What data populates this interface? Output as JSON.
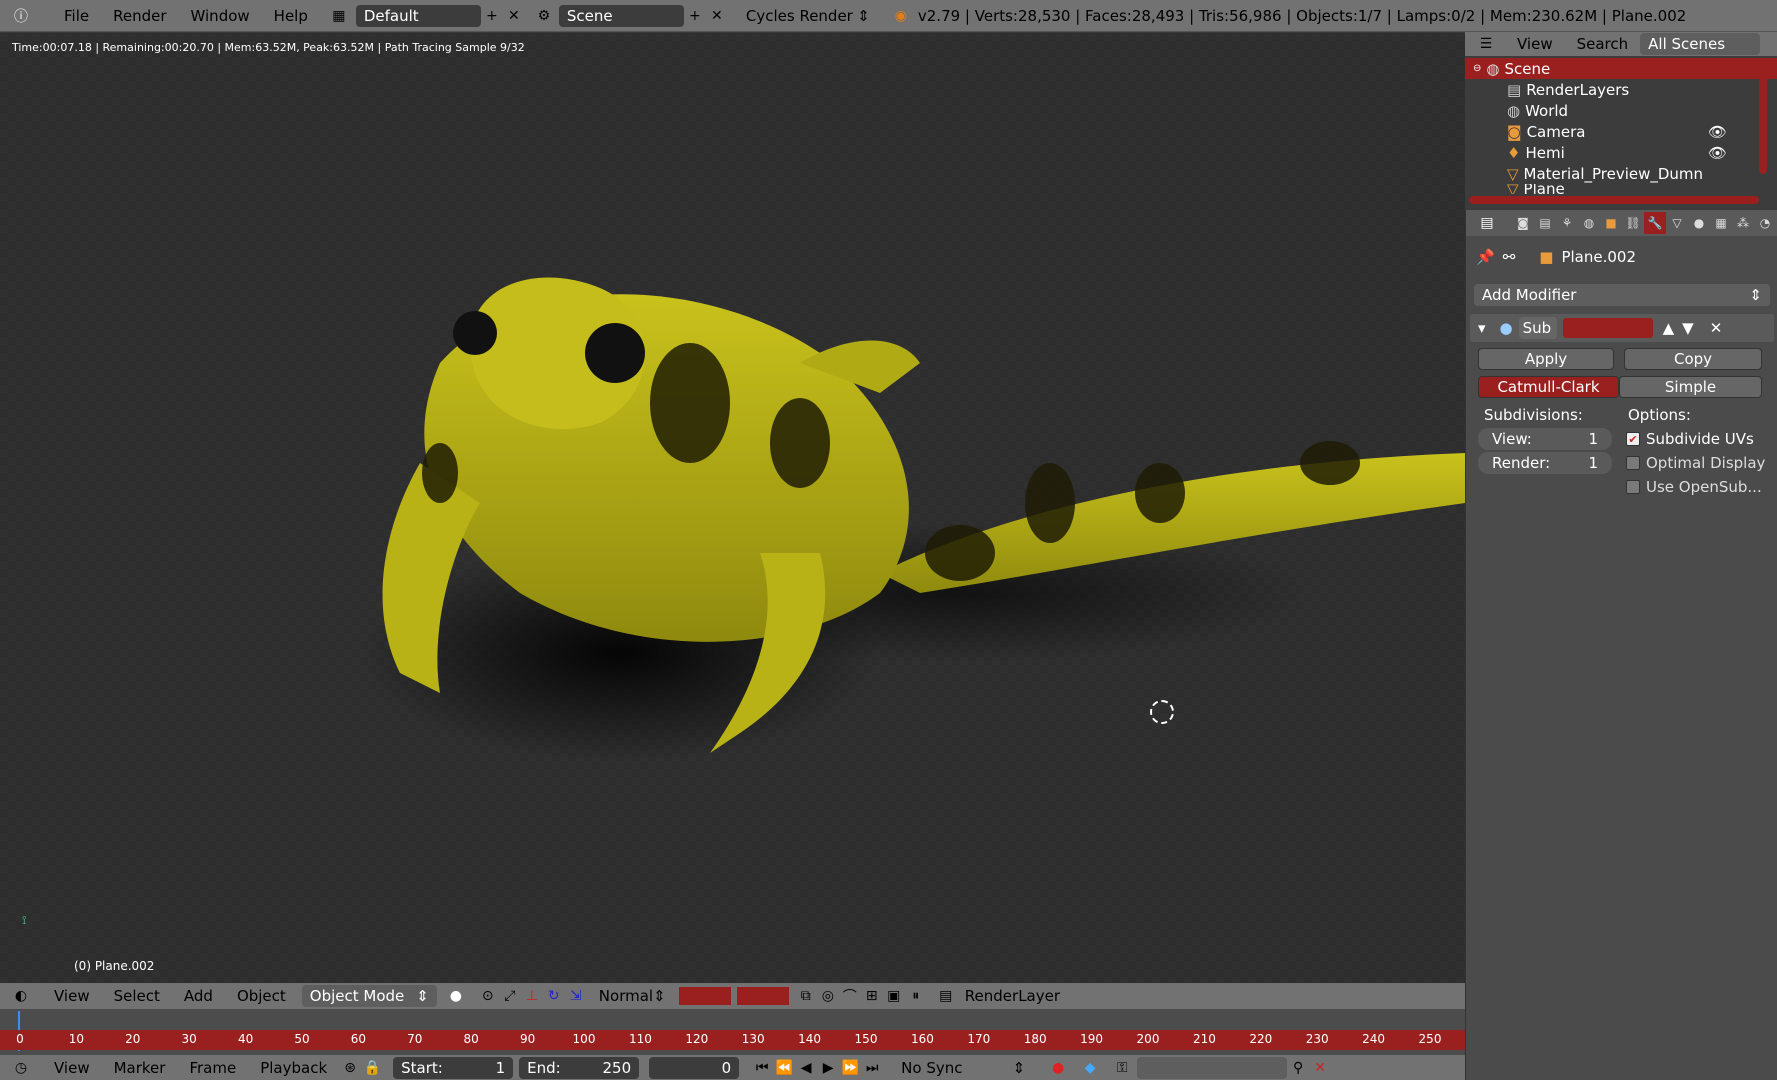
{
  "topbar": {
    "menus": [
      "File",
      "Render",
      "Window",
      "Help"
    ],
    "screen_layout": "Default",
    "scene": "Scene",
    "engine": "Cycles Render",
    "stats": "v2.79 | Verts:28,530 | Faces:28,493 | Tris:56,986 | Objects:1/7 | Lamps:0/2 | Mem:230.62M | Plane.002"
  },
  "viewport": {
    "render_info": "Time:00:07.18 | Remaining:00:20.70 | Mem:63.52M, Peak:63.52M | Path Tracing Sample 9/32",
    "object_label": "(0) Plane.002",
    "header": {
      "menus": [
        "View",
        "Select",
        "Add",
        "Object"
      ],
      "mode": "Object Mode",
      "orientation": "Normal",
      "render_layer": "RenderLayer"
    }
  },
  "timeline": {
    "ticks": [
      "0",
      "10",
      "20",
      "30",
      "40",
      "50",
      "60",
      "70",
      "80",
      "90",
      "100",
      "110",
      "120",
      "130",
      "140",
      "150",
      "160",
      "170",
      "180",
      "190",
      "200",
      "210",
      "220",
      "230",
      "240",
      "250"
    ],
    "menus": [
      "View",
      "Marker",
      "Frame",
      "Playback"
    ],
    "start_label": "Start:",
    "start_value": "1",
    "end_label": "End:",
    "end_value": "250",
    "current_frame": "0",
    "sync": "No Sync"
  },
  "outliner": {
    "header": {
      "view": "View",
      "search": "Search",
      "scenes": "All Scenes"
    },
    "items": [
      "Scene",
      "RenderLayers",
      "World",
      "Camera",
      "Hemi",
      "Material_Preview_Dumn",
      "Plane"
    ]
  },
  "properties": {
    "object_name": "Plane.002",
    "add_modifier": "Add Modifier",
    "modifier_name": "Sub",
    "apply": "Apply",
    "copy": "Copy",
    "type_catmull": "Catmull-Clark",
    "type_simple": "Simple",
    "subdivisions_label": "Subdivisions:",
    "options_label": "Options:",
    "view_label": "View:",
    "view_value": "1",
    "render_label": "Render:",
    "render_value": "1",
    "opt_subdivide_uvs": "Subdivide UVs",
    "opt_optimal_display": "Optimal Display",
    "opt_use_opensub": "Use OpenSub..."
  },
  "colors": {
    "accent_red": "#9a2020",
    "header_gray": "#727272",
    "frog_yellow": "#c8c21a"
  }
}
